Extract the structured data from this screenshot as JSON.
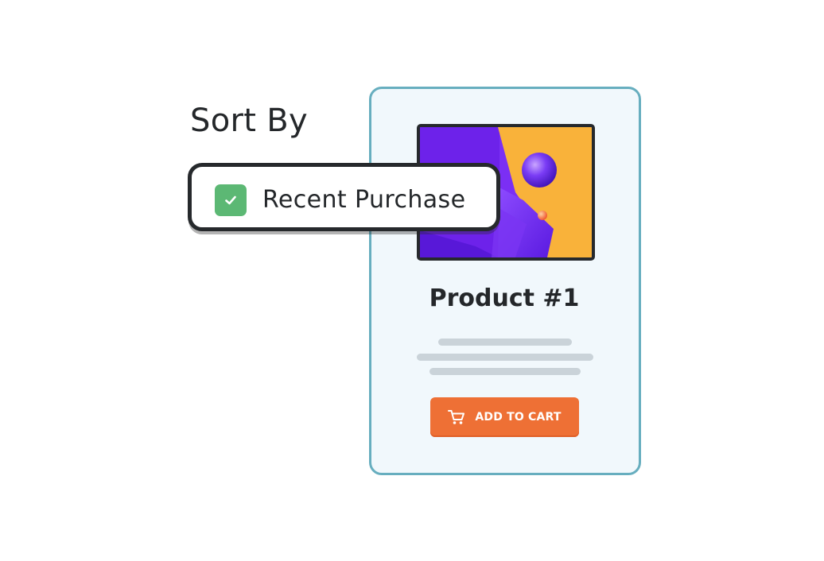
{
  "sort": {
    "title": "Sort By",
    "option": {
      "label": "Recent Purchase",
      "checked": true,
      "check_icon": "check-icon",
      "checkbox_color": "#5cb874"
    }
  },
  "product": {
    "title": "Product #1",
    "image_icon": "abstract-3d-shapes-image",
    "add_to_cart_label": "ADD TO CART",
    "cart_icon": "shopping-cart-icon",
    "button_color": "#ee7035",
    "card_border_color": "#67aebf",
    "card_background": "#f1f8fc"
  }
}
